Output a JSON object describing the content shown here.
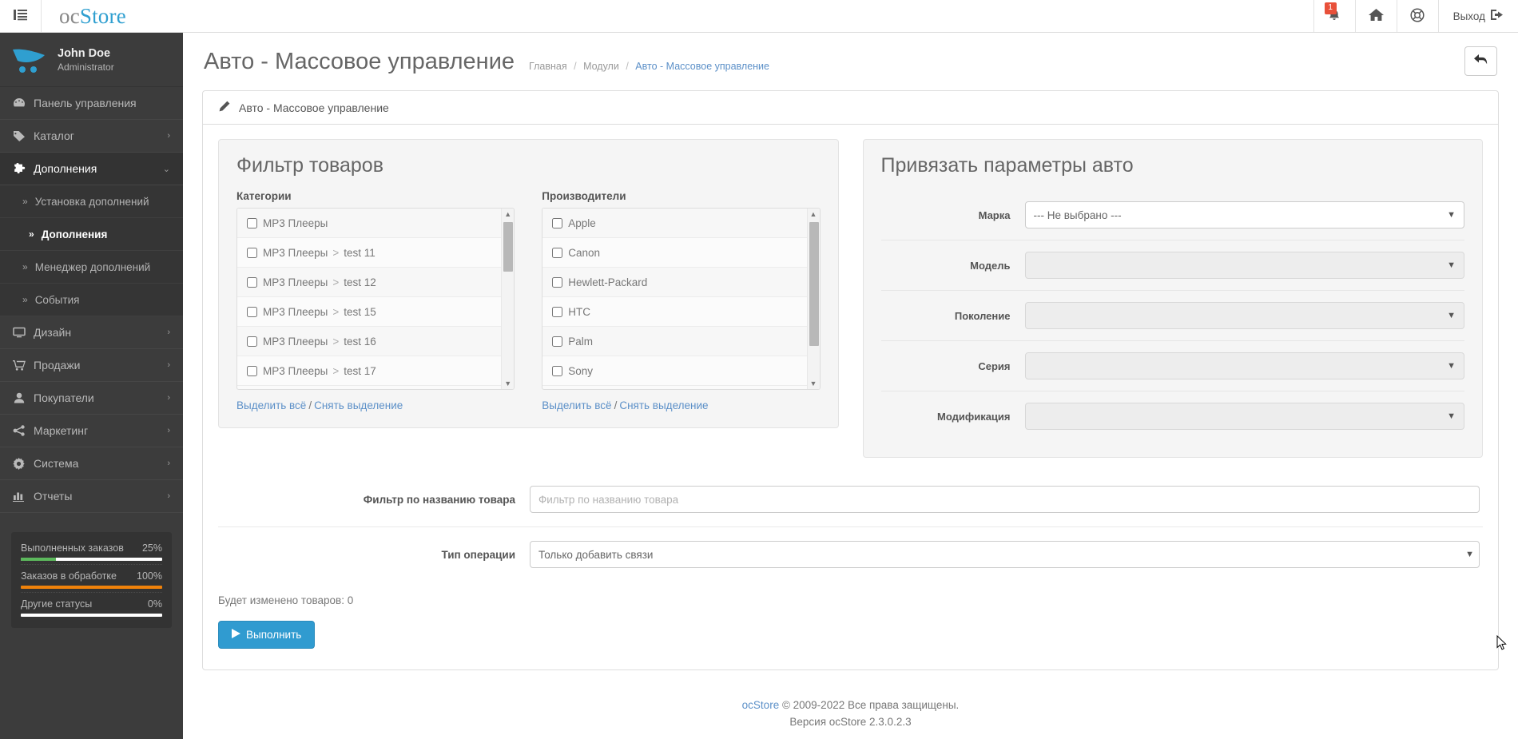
{
  "header": {
    "menu_toggle": "menu-toggle",
    "brand_part1": "oc",
    "brand_part2": "Store",
    "notifications_badge": "1",
    "logout_label": "Выход"
  },
  "sidebar": {
    "user_name": "John Doe",
    "user_role": "Administrator",
    "items": [
      {
        "label": "Панель управления",
        "icon": "dashboard-icon",
        "caret": "",
        "active": false
      },
      {
        "label": "Каталог",
        "icon": "tag-icon",
        "caret": "›",
        "active": false
      },
      {
        "label": "Дополнения",
        "icon": "puzzle-icon",
        "caret": "⌄",
        "active": true
      }
    ],
    "sub_items": [
      {
        "label": "Установка дополнений",
        "current": false
      },
      {
        "label": "Дополнения",
        "current": true
      },
      {
        "label": "Менеджер дополнений",
        "current": false
      },
      {
        "label": "События",
        "current": false
      }
    ],
    "items_after": [
      {
        "label": "Дизайн",
        "icon": "monitor-icon",
        "caret": "›"
      },
      {
        "label": "Продажи",
        "icon": "cart-icon",
        "caret": "›"
      },
      {
        "label": "Покупатели",
        "icon": "user-icon",
        "caret": "›"
      },
      {
        "label": "Маркетинг",
        "icon": "share-icon",
        "caret": "›"
      },
      {
        "label": "Система",
        "icon": "gear-icon",
        "caret": "›"
      },
      {
        "label": "Отчеты",
        "icon": "chart-icon",
        "caret": "›"
      }
    ],
    "stats": [
      {
        "label": "Выполненных заказов",
        "value": "25%",
        "pct": 25,
        "color": "#5cb85c"
      },
      {
        "label": "Заказов в обработке",
        "value": "100%",
        "pct": 100,
        "color": "#f0820a"
      },
      {
        "label": "Другие статусы",
        "value": "0%",
        "pct": 0,
        "color": "#ffffff"
      }
    ]
  },
  "page": {
    "title": "Авто - Массовое управление",
    "breadcrumb": [
      {
        "label": "Главная",
        "last": false
      },
      {
        "label": "Модули",
        "last": false
      },
      {
        "label": "Авто - Массовое управление",
        "last": true
      }
    ],
    "back_button": "back-arrow-icon",
    "panel_title": "Авто - Массовое управление"
  },
  "filter_panel": {
    "heading": "Фильтр товаров",
    "categories_label": "Категории",
    "categories": [
      {
        "parent": "MP3 Плееры",
        "child": ""
      },
      {
        "parent": "MP3 Плееры",
        "child": "test 11"
      },
      {
        "parent": "MP3 Плееры",
        "child": "test 12"
      },
      {
        "parent": "MP3 Плееры",
        "child": "test 15"
      },
      {
        "parent": "MP3 Плееры",
        "child": "test 16"
      },
      {
        "parent": "MP3 Плееры",
        "child": "test 17"
      }
    ],
    "manufacturers_label": "Производители",
    "manufacturers": [
      {
        "parent": "Apple",
        "child": ""
      },
      {
        "parent": "Canon",
        "child": ""
      },
      {
        "parent": "Hewlett-Packard",
        "child": ""
      },
      {
        "parent": "HTC",
        "child": ""
      },
      {
        "parent": "Palm",
        "child": ""
      },
      {
        "parent": "Sony",
        "child": ""
      }
    ],
    "select_all": "Выделить всё",
    "deselect_all": "Снять выделение",
    "separator": "/"
  },
  "auto_panel": {
    "heading": "Привязать параметры авто",
    "fields": [
      {
        "label": "Марка",
        "value": "--- Не выбрано ---",
        "disabled": false
      },
      {
        "label": "Модель",
        "value": "",
        "disabled": true
      },
      {
        "label": "Поколение",
        "value": "",
        "disabled": true
      },
      {
        "label": "Серия",
        "value": "",
        "disabled": true
      },
      {
        "label": "Модификация",
        "value": "",
        "disabled": true
      }
    ]
  },
  "bottom_form": {
    "name_filter_label": "Фильтр по названию товара",
    "name_filter_placeholder": "Фильтр по названию товара",
    "name_filter_value": "",
    "operation_label": "Тип операции",
    "operation_value": "Только добавить связи",
    "changed_note": "Будет изменено товаров: 0",
    "run_button": "Выполнить"
  },
  "footer": {
    "brand": "ocStore",
    "copyright": " © 2009-2022 Все права защищены.",
    "version": "Версия ocStore 2.3.0.2.3"
  }
}
